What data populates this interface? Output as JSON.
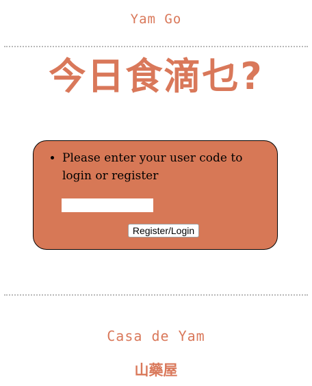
{
  "header": {
    "brand": "Yam Go",
    "headline": "今日食滴乜?"
  },
  "login": {
    "prompt": "Please enter your user code to login or register",
    "input_value": "",
    "input_placeholder": "",
    "button_label": "Register/Login"
  },
  "footer": {
    "name": "Casa de Yam",
    "chinese_name": "山藥屋"
  },
  "colors": {
    "accent": "#d9785a",
    "panel": "#d77856",
    "divider": "#b8b8b8"
  }
}
